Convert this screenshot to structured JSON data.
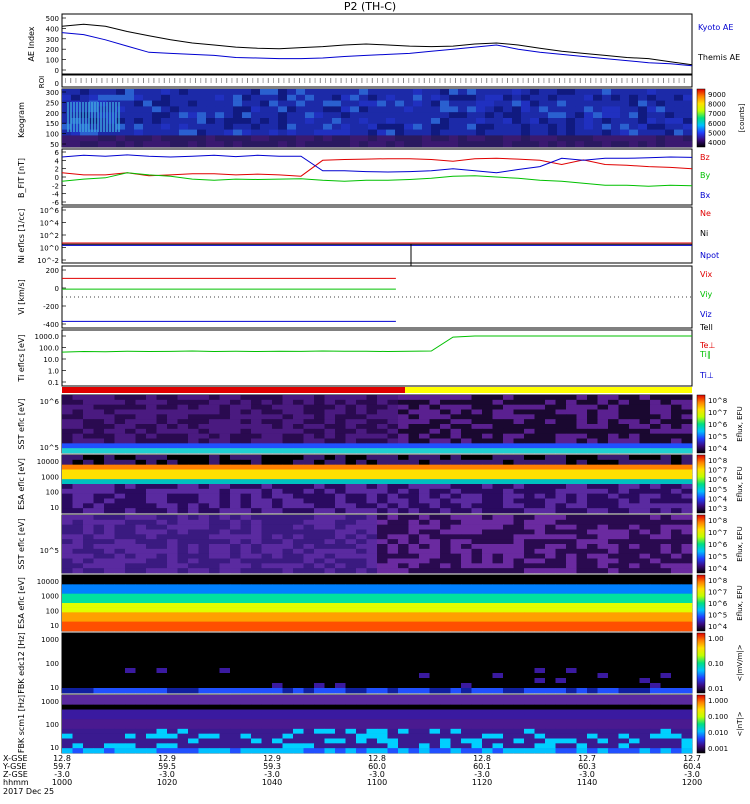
{
  "title": "P2 (TH-C)",
  "colors": {
    "red": "#e00000",
    "green": "#00c000",
    "blue": "#0000d0",
    "black": "#000000",
    "yellow": "#ffff00"
  },
  "footer": {
    "row_labels": [
      "X-GSE",
      "Y-GSE",
      "Z-GSE",
      "hhmm",
      "2017 Dec 25"
    ],
    "columns": [
      {
        "x": "12.8",
        "y": "59.7",
        "z": "-3.0",
        "t": "1000"
      },
      {
        "x": "12.9",
        "y": "59.5",
        "z": "-3.0",
        "t": "1020"
      },
      {
        "x": "12.9",
        "y": "59.3",
        "z": "-3.0",
        "t": "1040"
      },
      {
        "x": "12.8",
        "y": "60.0",
        "z": "-3.0",
        "t": "1100"
      },
      {
        "x": "12.8",
        "y": "60.1",
        "z": "-3.0",
        "t": "1120"
      },
      {
        "x": "12.7",
        "y": "60.3",
        "z": "-3.0",
        "t": "1140"
      },
      {
        "x": "12.7",
        "y": "60.4",
        "z": "-3.0",
        "t": "1200"
      }
    ]
  },
  "chart_data": [
    {
      "type": "line",
      "ylabel": "AE Index",
      "ylim": [
        0,
        500
      ],
      "yticks": [
        "500",
        "400",
        "300",
        "200",
        "100",
        "0"
      ],
      "x_time": [
        "1000",
        "1020",
        "1040",
        "1100",
        "1120",
        "1140",
        "1200"
      ],
      "series": [
        {
          "name": "Kyoto AE",
          "color": "#0000d0",
          "values": [
            360,
            340,
            290,
            230,
            170,
            160,
            150,
            140,
            120,
            115,
            110,
            110,
            115,
            130,
            140,
            150,
            160,
            180,
            200,
            220,
            240,
            200,
            170,
            150,
            130,
            110,
            90,
            70,
            60,
            40
          ]
        },
        {
          "name": "Themis AE",
          "color": "#000000",
          "values": [
            420,
            440,
            420,
            370,
            330,
            290,
            260,
            240,
            220,
            210,
            205,
            215,
            225,
            240,
            250,
            240,
            230,
            225,
            230,
            250,
            260,
            240,
            210,
            180,
            160,
            140,
            120,
            110,
            80,
            50
          ]
        }
      ]
    },
    {
      "type": "heatmap",
      "ylabel": "ROI",
      "yticks": [
        "0"
      ]
    },
    {
      "type": "heatmap",
      "ylabel": "Keogram",
      "yticks": [
        "300",
        "250",
        "200",
        "150",
        "100",
        "50"
      ],
      "colorbar": {
        "ticks": [
          "9000",
          "8000",
          "7000",
          "6000",
          "5000",
          "4000"
        ],
        "label": "[counts]"
      }
    },
    {
      "type": "line",
      "ylabel": "B_FIT [nT]",
      "ylim": [
        -6,
        6
      ],
      "yticks": [
        "6",
        "4",
        "2",
        "0",
        "-2",
        "-4",
        "-6"
      ],
      "series": [
        {
          "name": "Bz",
          "color": "#e00000",
          "values": [
            1.0,
            0.5,
            0.5,
            1.0,
            0.3,
            0.5,
            0.8,
            0.8,
            0.5,
            0.7,
            0.5,
            0.2,
            4.0,
            4.2,
            4.3,
            4.4,
            4.4,
            4.2,
            3.8,
            4.4,
            4.5,
            4.3,
            4.0,
            3.0,
            4.1,
            3.0,
            2.8,
            2.5,
            2.3,
            2.0
          ]
        },
        {
          "name": "By",
          "color": "#00c000",
          "values": [
            -1.0,
            -0.5,
            -0.2,
            1.0,
            0.5,
            0.2,
            -0.5,
            -0.8,
            -0.5,
            -0.6,
            -0.5,
            -0.4,
            -0.8,
            -1.0,
            -0.8,
            -0.8,
            -0.6,
            -0.3,
            0.2,
            0.3,
            0.0,
            -0.3,
            -0.8,
            -1.0,
            -1.5,
            -2.0,
            -2.0,
            -2.2,
            -2.0,
            -2.1
          ]
        },
        {
          "name": "Bx",
          "color": "#0000d0",
          "values": [
            4.8,
            5.2,
            5.0,
            5.3,
            5.0,
            4.8,
            5.0,
            5.2,
            4.9,
            5.2,
            5.0,
            5.0,
            1.5,
            1.5,
            1.3,
            1.2,
            1.3,
            1.5,
            2.0,
            1.5,
            1.0,
            1.8,
            2.5,
            4.5,
            4.0,
            4.5,
            4.5,
            4.6,
            4.8,
            4.7
          ]
        }
      ]
    },
    {
      "type": "line",
      "ylabel": "Ni eflcs [1/cc]",
      "yticks": [
        "10^6",
        "10^4",
        "10^2",
        "10^0",
        "10^-2"
      ],
      "series": [
        {
          "name": "Ne",
          "color": "#e00000",
          "values": [
            0.55,
            0.55,
            0.55,
            0.55,
            0.55,
            0.55,
            0.55,
            0.55,
            0.55,
            0.55,
            0.55,
            0.55,
            0.55,
            0.55,
            0.55,
            0.55,
            0.55,
            0.55,
            0.55,
            0.55,
            0.55,
            0.55,
            0.55,
            0.55,
            0.55,
            0.55,
            0.55,
            0.55,
            0.55,
            0.55
          ]
        },
        {
          "name": "Ni",
          "color": "#000000",
          "values": [
            0.52,
            0.52,
            0.52,
            0.52,
            0.52,
            0.52,
            0.52,
            0.52,
            0.52,
            0.52,
            0.52,
            0.52,
            0.52,
            0.52,
            0.52,
            0.52,
            0.52,
            0.52,
            0.52,
            0.52,
            0.52,
            0.52,
            0.52,
            0.52,
            0.52,
            0.52,
            0.52,
            0.52,
            0.52,
            0.52
          ]
        },
        {
          "name": "Npot",
          "color": "#0000d0",
          "values": [
            0.5,
            0.5,
            0.5,
            0.5,
            0.5,
            0.5,
            0.5,
            0.5,
            0.5,
            0.5,
            0.5,
            0.5,
            0.5,
            0.5,
            0.5,
            0.5,
            0.5,
            0.5,
            0.5,
            0.5,
            0.5,
            0.5,
            0.5,
            0.5,
            0.5,
            0.5,
            0.5,
            0.5,
            0.5,
            0.5
          ]
        }
      ]
    },
    {
      "type": "line",
      "ylabel": "Vi [km/s]",
      "ylim": [
        -400,
        200
      ],
      "yticks": [
        "200",
        "0",
        "-200",
        "-400"
      ],
      "series": [
        {
          "name": "Vix",
          "color": "#e00000",
          "values": [
            100,
            100,
            100,
            100,
            100,
            100,
            100,
            100,
            100,
            100,
            100,
            100,
            100,
            100,
            100,
            100,
            100,
            100,
            100,
            100,
            100,
            100,
            100,
            100,
            100,
            100
          ]
        },
        {
          "name": "Viy",
          "color": "#00c000",
          "values": [
            -30,
            -30,
            -30,
            -30,
            -30,
            -30,
            -30,
            -30,
            -30,
            -30,
            -30,
            -30,
            -30,
            -30,
            -30,
            -30,
            -30,
            -30,
            -30,
            -30,
            -30,
            -30,
            -30,
            -30,
            -30,
            -30
          ]
        },
        {
          "name": "Viz",
          "color": "#0000d0",
          "values": [
            -420,
            -420,
            -420,
            -420,
            -420,
            -420,
            -420,
            -420,
            -420,
            -420,
            -420,
            -420,
            -420,
            -420,
            -420,
            -420,
            -420,
            -420,
            -420,
            -420,
            -420,
            -420,
            -420,
            -420,
            -420,
            -420
          ]
        }
      ]
    },
    {
      "type": "line",
      "ylabel": "Ti eflcs [eV]",
      "yticks": [
        "1000.0",
        "100.0",
        "10.0",
        "1.0",
        "0.1"
      ],
      "series": [
        {
          "name": "Tell",
          "color": "#000000",
          "values": []
        },
        {
          "name": "Te⊥",
          "color": "#e00000",
          "values": []
        },
        {
          "name": "Ti∥",
          "color": "#00c000",
          "values": [
            40,
            45,
            42,
            48,
            45,
            46,
            50,
            45,
            47,
            45,
            48,
            46,
            50,
            48,
            47,
            45,
            48,
            50,
            800,
            1000,
            1000,
            1000,
            1000,
            1000,
            1000,
            1000,
            1000,
            1000,
            1000,
            1000
          ]
        },
        {
          "name": "Ti⊥",
          "color": "#0000d0",
          "values": []
        }
      ]
    },
    {
      "type": "heatmap",
      "ylabel": "SST eflc [eV]",
      "yticks": [
        "10^6",
        "10^5"
      ],
      "colorbar": {
        "ticks": [
          "10^8",
          "10^7",
          "10^6",
          "10^5",
          "10^4"
        ],
        "label": "Eflux, EFU"
      }
    },
    {
      "type": "heatmap",
      "ylabel": "ESA eflc [eV]",
      "yticks": [
        "10000",
        "1000",
        "100",
        "10"
      ],
      "colorbar": {
        "ticks": [
          "10^8",
          "10^7",
          "10^6",
          "10^5",
          "10^4",
          "10^3"
        ],
        "label": "Eflux, EFU"
      }
    },
    {
      "type": "heatmap",
      "ylabel": "SST eflc [eV]",
      "yticks": [
        "10^5"
      ],
      "colorbar": {
        "ticks": [
          "10^8",
          "10^7",
          "10^6",
          "10^5",
          "10^4"
        ],
        "label": "Eflux, EFU"
      }
    },
    {
      "type": "heatmap",
      "ylabel": "ESA eflc [eV]",
      "yticks": [
        "10000",
        "1000",
        "100",
        "10"
      ],
      "colorbar": {
        "ticks": [
          "10^8",
          "10^7",
          "10^6",
          "10^5",
          "10^4"
        ],
        "label": "Eflux, EFU"
      }
    },
    {
      "type": "heatmap",
      "ylabel": "FBK edc12 [Hz]",
      "yticks": [
        "1000",
        "100",
        "10"
      ],
      "colorbar": {
        "ticks": [
          "1.00",
          "0.10",
          "0.01"
        ],
        "label": "<|mV/m|>"
      }
    },
    {
      "type": "heatmap",
      "ylabel": "FBK scm1 [Hz]",
      "yticks": [
        "1000",
        "100",
        "10"
      ],
      "colorbar": {
        "ticks": [
          "1.000",
          "0.100",
          "0.010",
          "0.001"
        ],
        "label": "<|nT|>"
      }
    }
  ]
}
